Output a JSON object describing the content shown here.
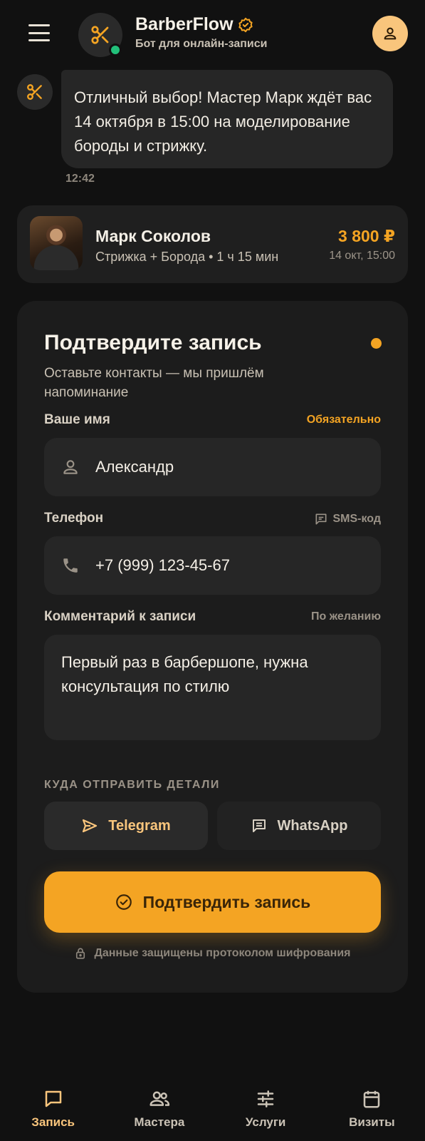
{
  "header": {
    "brand_name": "BarberFlow",
    "brand_subtitle": "Бот для онлайн-записи",
    "icons": [
      "menu-icon",
      "scissors-icon",
      "verified-badge-icon",
      "user-icon"
    ]
  },
  "chat": {
    "message": "Отличный выбор! Мастер Марк ждёт вас 14 октября в 15:00 на моделирование бороды и стрижку.",
    "time": "12:42"
  },
  "booking": {
    "master_name": "Марк Соколов",
    "service": "Стрижка + Борода • 1 ч 15 мин",
    "price": "3 800 ₽",
    "date": "14 окт, 15:00"
  },
  "form": {
    "title": "Подтвердите запись",
    "subtitle": "Оставьте контакты — мы пришлём напоминание",
    "name": {
      "label": "Ваше имя",
      "hint": "Обязательно",
      "value": "Александр"
    },
    "phone": {
      "label": "Телефон",
      "hint": "SMS-код",
      "value": "+7 (999) 123-45-67"
    },
    "comment": {
      "label": "Комментарий к записи",
      "hint": "По желанию",
      "value": "Первый раз в барбершопе, нужна консультация по стилю"
    },
    "send_label": "КУДА ОТПРАВИТЬ ДЕТАЛИ",
    "channels": [
      {
        "label": "Telegram",
        "selected": true
      },
      {
        "label": "WhatsApp",
        "selected": false
      }
    ],
    "confirm_label": "Подтвердить запись",
    "security_note": "Данные защищены протоколом шифрования"
  },
  "nav": {
    "items": [
      {
        "label": "Запись",
        "icon": "chat-icon",
        "active": true
      },
      {
        "label": "Мастера",
        "icon": "masters-icon",
        "active": false
      },
      {
        "label": "Услуги",
        "icon": "sliders-icon",
        "active": false
      },
      {
        "label": "Визиты",
        "icon": "calendar-icon",
        "active": false
      }
    ]
  },
  "colors": {
    "background": "#111111",
    "accent": "#f4a423",
    "online": "#22c07a"
  }
}
